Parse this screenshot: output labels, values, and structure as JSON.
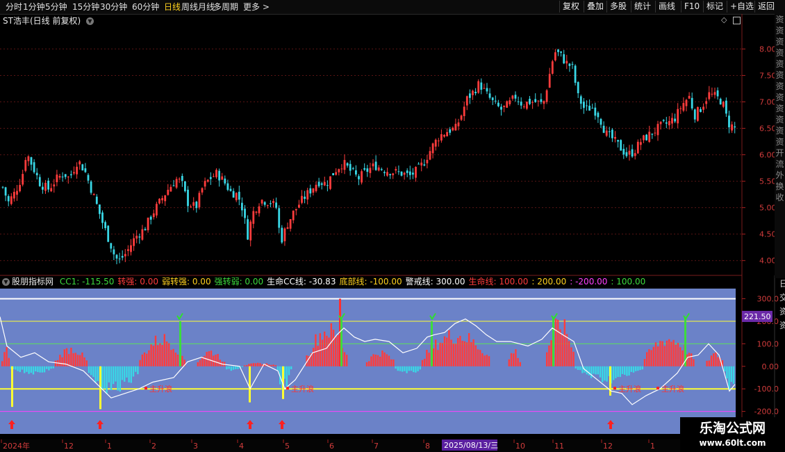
{
  "periods": [
    "分时",
    "1分钟",
    "5分钟",
    "15分钟",
    "30分钟",
    "60分钟",
    "日线",
    "周线",
    "月线",
    "多周期",
    "更多 >"
  ],
  "active_period": "日线",
  "right_buttons": [
    "复权",
    "叠加",
    "多股",
    "统计",
    "画线",
    "F10",
    "标记",
    "+自选",
    "返回"
  ],
  "stock_title": "ST浩丰(日线 前复权)",
  "main_axis_labels": [
    "8.00",
    "7.50",
    "7.00",
    "6.50",
    "6.00",
    "5.50",
    "5.00",
    "4.50",
    "4.00"
  ],
  "indicator": {
    "name": "股朋指标网",
    "items": [
      {
        "text": "CC1: -115.50",
        "color": "#3ddc3d"
      },
      {
        "text": "转强: 0.00",
        "color": "#ff3b3b"
      },
      {
        "text": "弱转强: 0.00",
        "color": "#ffd21e"
      },
      {
        "text": "强转弱: 0.00",
        "color": "#3ddc3d"
      },
      {
        "text": "生命CC线: -30.83",
        "color": "#ffffff"
      },
      {
        "text": "底部线: -100.00",
        "color": "#ffd21e"
      },
      {
        "text": "警戒线: 300.00",
        "color": "#ffffff"
      },
      {
        "text": "生命线: 100.00",
        "color": "#ff3b3b"
      },
      {
        "text": ": 200.00",
        "color": "#ffd21e"
      },
      {
        "text": ": -200.00",
        "color": "#ff40ff"
      },
      {
        "text": ": 100.00",
        "color": "#3ddc3d"
      }
    ]
  },
  "indicator_axis_labels": [
    "300.0",
    "200.0",
    "100.0",
    "0.00",
    "-100.0",
    "-200.0"
  ],
  "cursor_value": "221.50",
  "signal_label": "主升浪",
  "date_axis": {
    "labels": [
      "2024年",
      "12",
      "1",
      "2",
      "3",
      "4",
      "5",
      "6",
      "7",
      "8",
      "10",
      "11",
      "12",
      "1"
    ],
    "highlight": "2025/08/13/三"
  },
  "side_strip_chars": [
    "资",
    "资",
    "资",
    "资",
    "资",
    "资",
    "资",
    "资",
    "资",
    "资",
    "资",
    "资",
    "开",
    "流",
    "外",
    "换",
    "收"
  ],
  "side_strip_lower": [
    "日",
    "交",
    "资",
    "资"
  ],
  "watermark": {
    "title": "乐淘公式网",
    "url": "www.60lt.com"
  },
  "colors": {
    "up": "#ff3c3c",
    "down": "#39d7e6",
    "panel_bg": "#6b82c8",
    "accent": "#ffd21e"
  }
}
